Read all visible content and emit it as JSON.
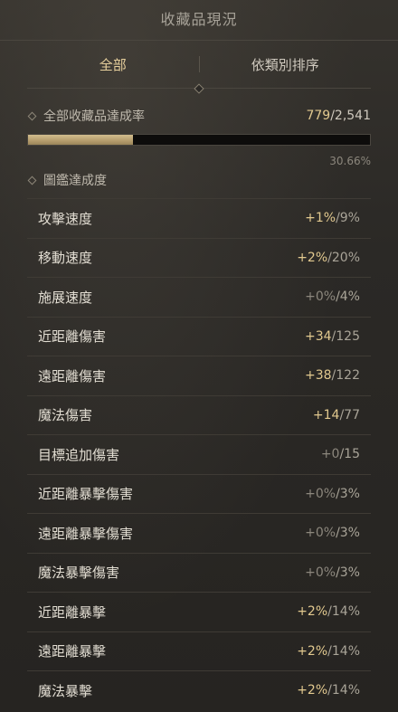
{
  "title": "收藏品現況",
  "tabs": [
    {
      "label": "全部",
      "active": true
    },
    {
      "label": "依類別排序",
      "active": false
    }
  ],
  "summary": {
    "label": "全部收藏品達成率",
    "collected": "779",
    "separator": "/",
    "total": "2,541",
    "progress": 0.3066,
    "percent": "30.66%"
  },
  "codex": {
    "label": "圖鑑達成度"
  },
  "stats": [
    {
      "name": "攻擊速度",
      "bonus": "+1%",
      "max": "/9%",
      "zero": false
    },
    {
      "name": "移動速度",
      "bonus": "+2%",
      "max": "/20%",
      "zero": false
    },
    {
      "name": "施展速度",
      "bonus": "+0%",
      "max": "/4%",
      "zero": true
    },
    {
      "name": "近距離傷害",
      "bonus": "+34",
      "max": "/125",
      "zero": false
    },
    {
      "name": "遠距離傷害",
      "bonus": "+38",
      "max": "/122",
      "zero": false
    },
    {
      "name": "魔法傷害",
      "bonus": "+14",
      "max": "/77",
      "zero": false
    },
    {
      "name": "目標追加傷害",
      "bonus": "+0",
      "max": "/15",
      "zero": true
    },
    {
      "name": "近距離暴擊傷害",
      "bonus": "+0%",
      "max": "/3%",
      "zero": true
    },
    {
      "name": "遠距離暴擊傷害",
      "bonus": "+0%",
      "max": "/3%",
      "zero": true
    },
    {
      "name": "魔法暴擊傷害",
      "bonus": "+0%",
      "max": "/3%",
      "zero": true
    },
    {
      "name": "近距離暴擊",
      "bonus": "+2%",
      "max": "/14%",
      "zero": false
    },
    {
      "name": "遠距離暴擊",
      "bonus": "+2%",
      "max": "/14%",
      "zero": false
    },
    {
      "name": "魔法暴擊",
      "bonus": "+2%",
      "max": "/14%",
      "zero": false
    }
  ]
}
